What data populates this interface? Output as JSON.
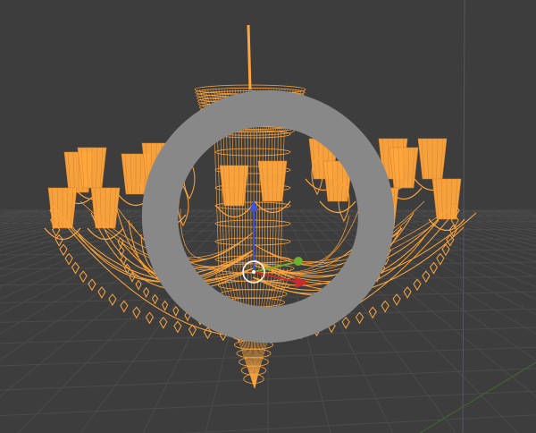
{
  "app": {
    "editor": "3D Viewport"
  },
  "scene": {
    "selected_object": "chandelier",
    "display_mode": "wireframe",
    "colors": {
      "background": "#3d3d3d",
      "grid": "#4a4a4a",
      "grid_major": "#505050",
      "selection": "#ffa63d",
      "selection_dark": "#d9822b",
      "axis_x": "#cc2b2b",
      "axis_y": "#6fb02c",
      "axis_z": "#3e55d8",
      "gizmo_ring": "#ffffff"
    },
    "icons": {
      "gizmo": "transform-gizmo-icon",
      "corner": "corner-drag-icon"
    }
  }
}
